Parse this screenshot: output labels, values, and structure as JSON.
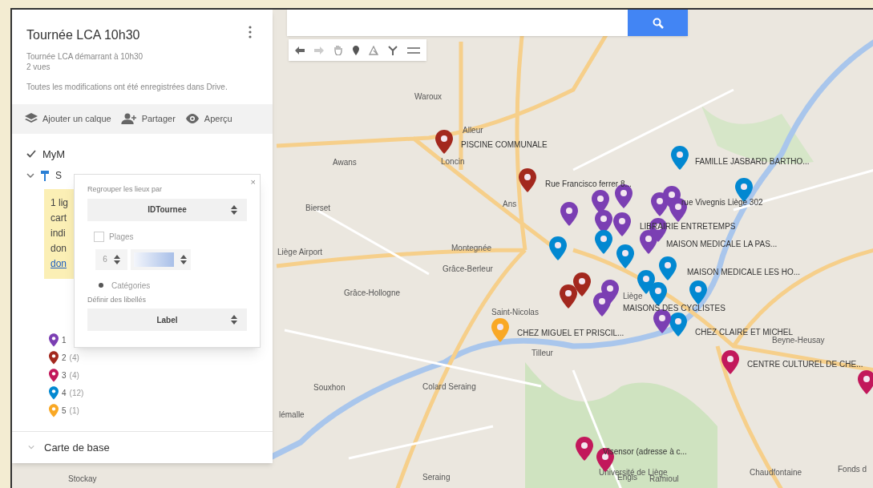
{
  "map_title": "Tournée LCA 10h30",
  "description": "Tournée LCA démarrant à 10h30",
  "views": "2 vues",
  "save_status": "Toutes les modifications ont été enregistrées dans Drive.",
  "actions": [
    {
      "kind": "layers",
      "label": "Ajouter un calque"
    },
    {
      "kind": "share",
      "label": "Partager"
    },
    {
      "kind": "preview",
      "label": "Aperçu"
    }
  ],
  "layer": {
    "name": "MyM",
    "checked": true,
    "expanded": true,
    "sublayer": "S"
  },
  "note": {
    "lines": [
      "1 lig",
      "cart",
      "indi",
      "don"
    ],
    "link": "don"
  },
  "legend": [
    {
      "label": "1",
      "color": "#7b3fb3"
    },
    {
      "label": "2",
      "count": "(4)",
      "color": "#a3281e"
    },
    {
      "label": "3",
      "count": "(4)",
      "color": "#c2185b"
    },
    {
      "label": "4",
      "count": "(12)",
      "color": "#0288d1"
    },
    {
      "label": "5",
      "count": "(1)",
      "color": "#f9a825"
    }
  ],
  "base_map": "Carte de base",
  "style_popup": {
    "group_label": "Regrouper les lieux par",
    "group_value": "IDTournee",
    "ranges": {
      "label": "Plages",
      "checked": false,
      "count": "6"
    },
    "categories": {
      "label": "Catégories",
      "selected": true
    },
    "labels_label": "Définir des libellés",
    "labels_value": "Label",
    "close": "×"
  },
  "places": [
    "Waroux",
    "Alleur",
    "Loncin",
    "Awans",
    "Ans",
    "Bierset",
    "Liège Airport",
    "Montegnée",
    "Grâce-Berleur",
    "Grâce-Hollogne",
    "Saint-Nicolas",
    "Tilleur",
    "Liège",
    "Souxhon",
    "Colard Seraing",
    "lémalle",
    "Seraing",
    "Université de Liège",
    "Chaudfontaine",
    "Fonds d",
    "Beyne-Heusay",
    "Stockay",
    "Engis",
    "Ramioul"
  ],
  "pin_labels": [
    "PISCINE COMMUNALE",
    "Rue Francisco ferrer 8...",
    "FAMILLE JASBARD BARTHO...",
    "rue Vivegnis Liège 302",
    "LIBRAIRIE ENTRETEMPS",
    "MAISON MEDICALE LA PAS...",
    "MAISON MEDICALE LES HO...",
    "MAISONS DES CYCLISTES",
    "CHEZ MIGUEL ET PRISCIL...",
    "CHEZ CLAIRE ET MICHEL",
    "CENTRE CULTUREL DE CHE...",
    "Visensor (adresse à c..."
  ],
  "pins": [
    {
      "color": "#a3281e"
    },
    {
      "color": "#a3281e"
    },
    {
      "color": "#0288d1"
    },
    {
      "color": "#0288d1"
    },
    {
      "color": "#7b3fb3"
    },
    {
      "color": "#7b3fb3"
    },
    {
      "color": "#7b3fb3"
    },
    {
      "color": "#7b3fb3"
    },
    {
      "color": "#7b3fb3"
    },
    {
      "color": "#7b3fb3"
    },
    {
      "color": "#7b3fb3"
    },
    {
      "color": "#7b3fb3"
    },
    {
      "color": "#7b3fb3"
    },
    {
      "color": "#7b3fb3"
    },
    {
      "color": "#0288d1"
    },
    {
      "color": "#0288d1"
    },
    {
      "color": "#0288d1"
    },
    {
      "color": "#0288d1"
    },
    {
      "color": "#0288d1"
    },
    {
      "color": "#0288d1"
    },
    {
      "color": "#0288d1"
    },
    {
      "color": "#0288d1"
    },
    {
      "color": "#a3281e"
    },
    {
      "color": "#a3281e"
    },
    {
      "color": "#7b3fb3"
    },
    {
      "color": "#7b3fb3"
    },
    {
      "color": "#7b3fb3"
    },
    {
      "color": "#f9a825"
    },
    {
      "color": "#c2185b"
    },
    {
      "color": "#c2185b"
    },
    {
      "color": "#c2185b"
    },
    {
      "color": "#c2185b"
    }
  ]
}
